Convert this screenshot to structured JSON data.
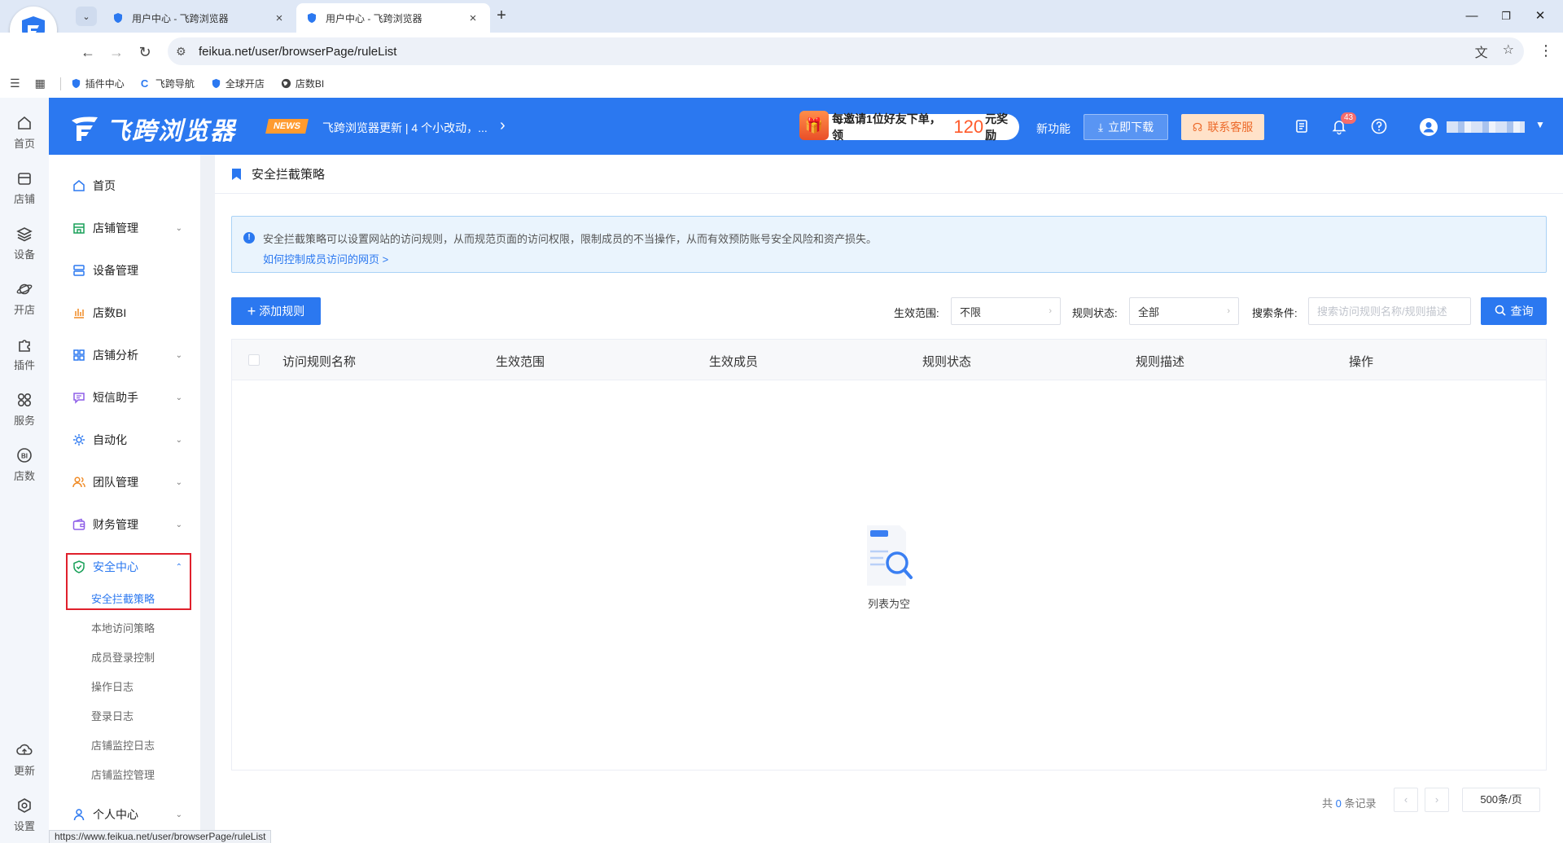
{
  "browser": {
    "tabs": [
      {
        "title": "用户中心 - 飞跨浏览器",
        "active": false
      },
      {
        "title": "用户中心 - 飞跨浏览器",
        "active": true
      }
    ],
    "url": "feikua.net/user/browserPage/ruleList",
    "bookmarks": [
      {
        "label": "插件中心",
        "icon": "shield-icon"
      },
      {
        "label": "飞跨导航",
        "icon": "c-logo-icon"
      },
      {
        "label": "全球开店",
        "icon": "shield-icon"
      },
      {
        "label": "店数BI",
        "icon": "globe-icon"
      }
    ],
    "status_url": "https://www.feikua.net/user/browserPage/ruleList"
  },
  "rail": {
    "items": [
      {
        "label": "首页",
        "icon": "home-icon"
      },
      {
        "label": "店铺",
        "icon": "store-icon"
      },
      {
        "label": "设备",
        "icon": "layers-icon"
      },
      {
        "label": "开店",
        "icon": "planet-icon"
      },
      {
        "label": "插件",
        "icon": "puzzle-icon"
      },
      {
        "label": "服务",
        "icon": "apps-icon"
      },
      {
        "label": "店数",
        "icon": "bi-icon"
      },
      {
        "label": "更新",
        "icon": "cloud-icon"
      },
      {
        "label": "设置",
        "icon": "settings-icon"
      }
    ]
  },
  "header": {
    "logo_text": "飞跨浏览器",
    "news_badge": "NEWS",
    "news_text": "飞跨浏览器更新 | 4 个小改动，...",
    "invite_prefix": "每邀请1位好友下单，领",
    "invite_amount": "120",
    "invite_suffix": "元奖励",
    "new_feature": "新功能",
    "download_label": "立即下载",
    "service_label": "联系客服",
    "notification_count": "43",
    "colors": {
      "brand": "#2b78f0",
      "news": "#ff9b2f",
      "accent_orange": "#ec6a2a",
      "alert_red": "#e0202c"
    }
  },
  "sidebar": {
    "items": [
      {
        "label": "首页",
        "icon": "home-icon",
        "expandable": false
      },
      {
        "label": "店铺管理",
        "icon": "shop-icon",
        "expandable": true
      },
      {
        "label": "设备管理",
        "icon": "server-icon",
        "expandable": false
      },
      {
        "label": "店数BI",
        "icon": "bar-chart-icon",
        "expandable": false
      },
      {
        "label": "店铺分析",
        "icon": "grid-icon",
        "expandable": true
      },
      {
        "label": "短信助手",
        "icon": "message-icon",
        "expandable": true
      },
      {
        "label": "自动化",
        "icon": "gear-icon",
        "expandable": true
      },
      {
        "label": "团队管理",
        "icon": "team-icon",
        "expandable": true
      },
      {
        "label": "财务管理",
        "icon": "wallet-icon",
        "expandable": true
      },
      {
        "label": "安全中心",
        "icon": "shield-check-icon",
        "expandable": true,
        "open": true
      }
    ],
    "sub_items": [
      {
        "label": "安全拦截策略",
        "active": true
      },
      {
        "label": "本地访问策略"
      },
      {
        "label": "成员登录控制"
      },
      {
        "label": "操作日志"
      },
      {
        "label": "登录日志"
      },
      {
        "label": "店铺监控日志"
      },
      {
        "label": "店铺监控管理"
      }
    ],
    "last_item": {
      "label": "个人中心",
      "icon": "user-icon",
      "expandable": true
    }
  },
  "main": {
    "page_title": "安全拦截策略",
    "alert": {
      "text": "安全拦截策略可以设置网站的访问规则，从而规范页面的访问权限，限制成员的不当操作，从而有效预防账号安全风险和资产损失。",
      "link": "如何控制成员访问的网页 >"
    },
    "add_rule_label": "添加规则",
    "filters": {
      "scope_label": "生效范围:",
      "scope_value": "不限",
      "status_label": "规则状态:",
      "status_value": "全部",
      "search_label": "搜索条件:",
      "search_placeholder": "搜索访问规则名称/规则描述",
      "query_label": "查询"
    },
    "table": {
      "columns": [
        "访问规则名称",
        "生效范围",
        "生效成员",
        "规则状态",
        "规则描述",
        "操作"
      ],
      "rows": [],
      "empty_text": "列表为空"
    },
    "pagination": {
      "total_prefix": "共",
      "total": "0",
      "total_suffix": "条记录",
      "page_size": "500条/页"
    }
  }
}
